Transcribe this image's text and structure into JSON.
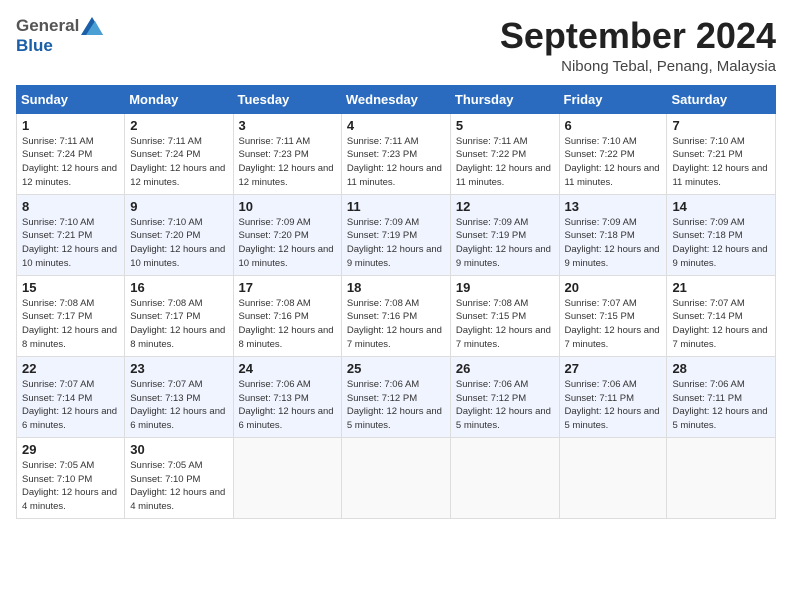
{
  "header": {
    "logo_general": "General",
    "logo_blue": "Blue",
    "month_title": "September 2024",
    "location": "Nibong Tebal, Penang, Malaysia"
  },
  "days_of_week": [
    "Sunday",
    "Monday",
    "Tuesday",
    "Wednesday",
    "Thursday",
    "Friday",
    "Saturday"
  ],
  "weeks": [
    [
      {
        "day": "1",
        "sunrise": "7:11 AM",
        "sunset": "7:24 PM",
        "daylight": "12 hours and 12 minutes."
      },
      {
        "day": "2",
        "sunrise": "7:11 AM",
        "sunset": "7:24 PM",
        "daylight": "12 hours and 12 minutes."
      },
      {
        "day": "3",
        "sunrise": "7:11 AM",
        "sunset": "7:23 PM",
        "daylight": "12 hours and 12 minutes."
      },
      {
        "day": "4",
        "sunrise": "7:11 AM",
        "sunset": "7:23 PM",
        "daylight": "12 hours and 11 minutes."
      },
      {
        "day": "5",
        "sunrise": "7:11 AM",
        "sunset": "7:22 PM",
        "daylight": "12 hours and 11 minutes."
      },
      {
        "day": "6",
        "sunrise": "7:10 AM",
        "sunset": "7:22 PM",
        "daylight": "12 hours and 11 minutes."
      },
      {
        "day": "7",
        "sunrise": "7:10 AM",
        "sunset": "7:21 PM",
        "daylight": "12 hours and 11 minutes."
      }
    ],
    [
      {
        "day": "8",
        "sunrise": "7:10 AM",
        "sunset": "7:21 PM",
        "daylight": "12 hours and 10 minutes."
      },
      {
        "day": "9",
        "sunrise": "7:10 AM",
        "sunset": "7:20 PM",
        "daylight": "12 hours and 10 minutes."
      },
      {
        "day": "10",
        "sunrise": "7:09 AM",
        "sunset": "7:20 PM",
        "daylight": "12 hours and 10 minutes."
      },
      {
        "day": "11",
        "sunrise": "7:09 AM",
        "sunset": "7:19 PM",
        "daylight": "12 hours and 9 minutes."
      },
      {
        "day": "12",
        "sunrise": "7:09 AM",
        "sunset": "7:19 PM",
        "daylight": "12 hours and 9 minutes."
      },
      {
        "day": "13",
        "sunrise": "7:09 AM",
        "sunset": "7:18 PM",
        "daylight": "12 hours and 9 minutes."
      },
      {
        "day": "14",
        "sunrise": "7:09 AM",
        "sunset": "7:18 PM",
        "daylight": "12 hours and 9 minutes."
      }
    ],
    [
      {
        "day": "15",
        "sunrise": "7:08 AM",
        "sunset": "7:17 PM",
        "daylight": "12 hours and 8 minutes."
      },
      {
        "day": "16",
        "sunrise": "7:08 AM",
        "sunset": "7:17 PM",
        "daylight": "12 hours and 8 minutes."
      },
      {
        "day": "17",
        "sunrise": "7:08 AM",
        "sunset": "7:16 PM",
        "daylight": "12 hours and 8 minutes."
      },
      {
        "day": "18",
        "sunrise": "7:08 AM",
        "sunset": "7:16 PM",
        "daylight": "12 hours and 7 minutes."
      },
      {
        "day": "19",
        "sunrise": "7:08 AM",
        "sunset": "7:15 PM",
        "daylight": "12 hours and 7 minutes."
      },
      {
        "day": "20",
        "sunrise": "7:07 AM",
        "sunset": "7:15 PM",
        "daylight": "12 hours and 7 minutes."
      },
      {
        "day": "21",
        "sunrise": "7:07 AM",
        "sunset": "7:14 PM",
        "daylight": "12 hours and 7 minutes."
      }
    ],
    [
      {
        "day": "22",
        "sunrise": "7:07 AM",
        "sunset": "7:14 PM",
        "daylight": "12 hours and 6 minutes."
      },
      {
        "day": "23",
        "sunrise": "7:07 AM",
        "sunset": "7:13 PM",
        "daylight": "12 hours and 6 minutes."
      },
      {
        "day": "24",
        "sunrise": "7:06 AM",
        "sunset": "7:13 PM",
        "daylight": "12 hours and 6 minutes."
      },
      {
        "day": "25",
        "sunrise": "7:06 AM",
        "sunset": "7:12 PM",
        "daylight": "12 hours and 5 minutes."
      },
      {
        "day": "26",
        "sunrise": "7:06 AM",
        "sunset": "7:12 PM",
        "daylight": "12 hours and 5 minutes."
      },
      {
        "day": "27",
        "sunrise": "7:06 AM",
        "sunset": "7:11 PM",
        "daylight": "12 hours and 5 minutes."
      },
      {
        "day": "28",
        "sunrise": "7:06 AM",
        "sunset": "7:11 PM",
        "daylight": "12 hours and 5 minutes."
      }
    ],
    [
      {
        "day": "29",
        "sunrise": "7:05 AM",
        "sunset": "7:10 PM",
        "daylight": "12 hours and 4 minutes."
      },
      {
        "day": "30",
        "sunrise": "7:05 AM",
        "sunset": "7:10 PM",
        "daylight": "12 hours and 4 minutes."
      },
      null,
      null,
      null,
      null,
      null
    ]
  ]
}
